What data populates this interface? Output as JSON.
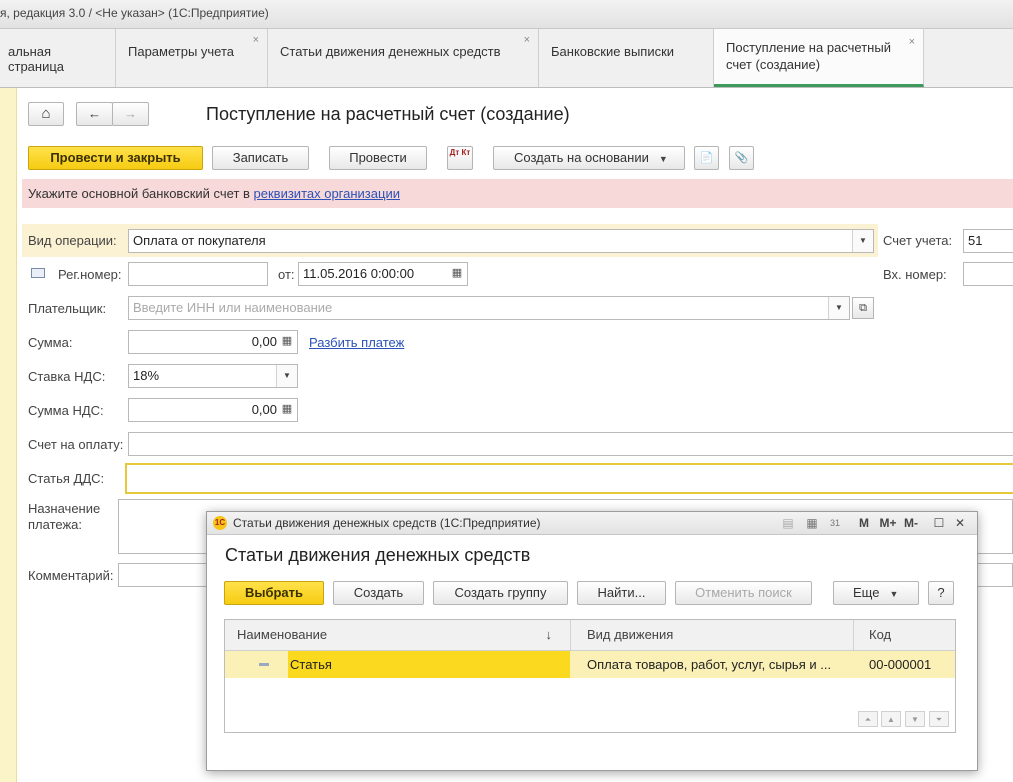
{
  "window": {
    "title": "я, редакция 3.0 / <Не указан>  (1С:Предприятие)"
  },
  "tabs": [
    {
      "label": "альная страница",
      "closable": false
    },
    {
      "label": "Параметры учета",
      "closable": true
    },
    {
      "label": "Статьи движения денежных средств",
      "closable": true
    },
    {
      "label": "Банковские выписки",
      "closable": false
    },
    {
      "label": "Поступление на расчетный счет (создание)",
      "closable": true
    }
  ],
  "tab_close_glyph": "×",
  "nav": {
    "home_icon": "⌂",
    "back_icon": "←",
    "forward_icon": "→"
  },
  "form": {
    "title": "Поступление на расчетный счет (создание)",
    "toolbar": {
      "post_close": "Провести и закрыть",
      "save": "Записать",
      "post": "Провести",
      "dtkt_icon": "Дт Кт",
      "create_based": "Создать на основании",
      "report_icon": "📄",
      "attach_icon": "📎"
    },
    "warning": {
      "text": "Укажите основной банковский счет в ",
      "link": "реквизитах организации"
    },
    "fields": {
      "op_type_label": "Вид операции:",
      "op_type_value": "Оплата от покупателя",
      "account_label": "Счет учета:",
      "account_value": "51",
      "reg_label": "Рег.номер:",
      "reg_value": "",
      "date_from_label": "от:",
      "date_value": "11.05.2016  0:00:00",
      "in_num_label": "Вх. номер:",
      "in_num_value": "",
      "payer_label": "Плательщик:",
      "payer_placeholder": "Введите ИНН или наименование",
      "sum_label": "Сумма:",
      "sum_value": "0,00",
      "split_link": "Разбить платеж",
      "vat_rate_label": "Ставка НДС:",
      "vat_rate_value": "18%",
      "vat_sum_label": "Сумма НДС:",
      "vat_sum_value": "0,00",
      "invoice_label": "Счет на оплату:",
      "invoice_value": "",
      "dds_label": "Статья ДДС:",
      "dds_value": "",
      "purpose_label_1": "Назначение",
      "purpose_label_2": "платежа:",
      "purpose_value": "",
      "comment_label": "Комментарий:",
      "comment_value": ""
    }
  },
  "modal": {
    "title": "Статьи движения денежных средств  (1С:Предприятие)",
    "heading": "Статьи движения денежных средств",
    "window_buttons": {
      "m": "M",
      "m_plus": "M+",
      "m_minus": "M-",
      "maximize": "☐",
      "close": "✕"
    },
    "toolbar": {
      "select": "Выбрать",
      "create": "Создать",
      "create_group": "Создать группу",
      "find": "Найти...",
      "cancel_search": "Отменить поиск",
      "more": "Еще",
      "help": "?"
    },
    "grid": {
      "columns": [
        "Наименование",
        "Вид движения",
        "Код"
      ],
      "sort_indicator": "↓",
      "rows": [
        {
          "name": "Статья",
          "movement": "Оплата товаров, работ, услуг, сырья и ...",
          "code": "00-000001"
        }
      ]
    }
  }
}
